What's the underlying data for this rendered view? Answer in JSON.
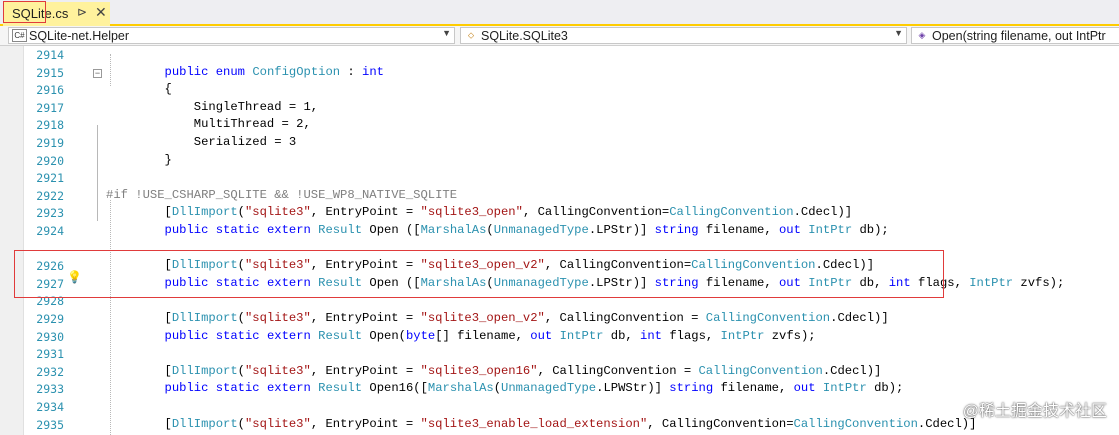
{
  "tab": {
    "filename": "SQLite.cs",
    "pin_glyph": "⊳",
    "close_glyph": "✕"
  },
  "navbar": {
    "project": {
      "icon": "C#",
      "label": "SQLite-net.Helper"
    },
    "type": {
      "icon": "⬦",
      "label": "SQLite.SQLite3"
    },
    "member": {
      "icon": "◈",
      "label": "Open(string filename, out IntPtr"
    }
  },
  "lines": [
    {
      "n": "2914",
      "segs": []
    },
    {
      "n": "2915",
      "segs": [
        {
          "t": "        "
        },
        {
          "t": "public",
          "c": "kw"
        },
        {
          "t": " "
        },
        {
          "t": "enum",
          "c": "kw"
        },
        {
          "t": " "
        },
        {
          "t": "ConfigOption",
          "c": "ty"
        },
        {
          "t": " : "
        },
        {
          "t": "int",
          "c": "kw"
        }
      ]
    },
    {
      "n": "2916",
      "segs": [
        {
          "t": "        {"
        }
      ]
    },
    {
      "n": "2917",
      "segs": [
        {
          "t": "            SingleThread = 1,"
        }
      ]
    },
    {
      "n": "2918",
      "segs": [
        {
          "t": "            MultiThread = 2,"
        }
      ]
    },
    {
      "n": "2919",
      "segs": [
        {
          "t": "            Serialized = 3"
        }
      ]
    },
    {
      "n": "2920",
      "segs": [
        {
          "t": "        }"
        }
      ]
    },
    {
      "n": "2921",
      "segs": []
    },
    {
      "n": "2922",
      "segs": [
        {
          "t": "#if !USE_CSHARP_SQLITE && !USE_WP8_NATIVE_SQLITE",
          "c": "pp"
        }
      ]
    },
    {
      "n": "2923",
      "segs": [
        {
          "t": "        ["
        },
        {
          "t": "DllImport",
          "c": "ty"
        },
        {
          "t": "("
        },
        {
          "t": "\"sqlite3\"",
          "c": "st"
        },
        {
          "t": ", EntryPoint = "
        },
        {
          "t": "\"sqlite3_open\"",
          "c": "st"
        },
        {
          "t": ", CallingConvention="
        },
        {
          "t": "CallingConvention",
          "c": "ty"
        },
        {
          "t": ".Cdecl)]"
        }
      ]
    },
    {
      "n": "2924",
      "segs": [
        {
          "t": "        "
        },
        {
          "t": "public",
          "c": "kw"
        },
        {
          "t": " "
        },
        {
          "t": "static",
          "c": "kw"
        },
        {
          "t": " "
        },
        {
          "t": "extern",
          "c": "kw"
        },
        {
          "t": " "
        },
        {
          "t": "Result",
          "c": "ty"
        },
        {
          "t": " Open (["
        },
        {
          "t": "MarshalAs",
          "c": "ty"
        },
        {
          "t": "("
        },
        {
          "t": "UnmanagedType",
          "c": "ty"
        },
        {
          "t": ".LPStr)] "
        },
        {
          "t": "string",
          "c": "kw"
        },
        {
          "t": " filename, "
        },
        {
          "t": "out",
          "c": "kw"
        },
        {
          "t": " "
        },
        {
          "t": "IntPtr",
          "c": "ty"
        },
        {
          "t": " db);"
        }
      ]
    },
    {
      "n": "",
      "segs": []
    },
    {
      "n": "2926",
      "segs": [
        {
          "t": "        ["
        },
        {
          "t": "DllImport",
          "c": "ty"
        },
        {
          "t": "("
        },
        {
          "t": "\"sqlite3\"",
          "c": "st"
        },
        {
          "t": ", EntryPoint = "
        },
        {
          "t": "\"sqlite3_open_v2\"",
          "c": "st"
        },
        {
          "t": ", CallingConvention="
        },
        {
          "t": "CallingConvention",
          "c": "ty"
        },
        {
          "t": ".Cdecl)]"
        }
      ]
    },
    {
      "n": "2927",
      "segs": [
        {
          "t": "        "
        },
        {
          "t": "public",
          "c": "kw"
        },
        {
          "t": " "
        },
        {
          "t": "static",
          "c": "kw"
        },
        {
          "t": " "
        },
        {
          "t": "extern",
          "c": "kw"
        },
        {
          "t": " "
        },
        {
          "t": "Result",
          "c": "ty"
        },
        {
          "t": " Open (["
        },
        {
          "t": "MarshalAs",
          "c": "ty"
        },
        {
          "t": "("
        },
        {
          "t": "UnmanagedType",
          "c": "ty"
        },
        {
          "t": ".LPStr)] "
        },
        {
          "t": "string",
          "c": "kw"
        },
        {
          "t": " filename, "
        },
        {
          "t": "out",
          "c": "kw"
        },
        {
          "t": " "
        },
        {
          "t": "IntPtr",
          "c": "ty"
        },
        {
          "t": " db, "
        },
        {
          "t": "int",
          "c": "kw"
        },
        {
          "t": " flags, "
        },
        {
          "t": "IntPtr",
          "c": "ty"
        },
        {
          "t": " zvfs);"
        }
      ]
    },
    {
      "n": "2928",
      "segs": []
    },
    {
      "n": "2929",
      "segs": [
        {
          "t": "        ["
        },
        {
          "t": "DllImport",
          "c": "ty"
        },
        {
          "t": "("
        },
        {
          "t": "\"sqlite3\"",
          "c": "st"
        },
        {
          "t": ", EntryPoint = "
        },
        {
          "t": "\"sqlite3_open_v2\"",
          "c": "st"
        },
        {
          "t": ", CallingConvention = "
        },
        {
          "t": "CallingConvention",
          "c": "ty"
        },
        {
          "t": ".Cdecl)]"
        }
      ]
    },
    {
      "n": "2930",
      "segs": [
        {
          "t": "        "
        },
        {
          "t": "public",
          "c": "kw"
        },
        {
          "t": " "
        },
        {
          "t": "static",
          "c": "kw"
        },
        {
          "t": " "
        },
        {
          "t": "extern",
          "c": "kw"
        },
        {
          "t": " "
        },
        {
          "t": "Result",
          "c": "ty"
        },
        {
          "t": " Open("
        },
        {
          "t": "byte",
          "c": "kw"
        },
        {
          "t": "[] filename, "
        },
        {
          "t": "out",
          "c": "kw"
        },
        {
          "t": " "
        },
        {
          "t": "IntPtr",
          "c": "ty"
        },
        {
          "t": " db, "
        },
        {
          "t": "int",
          "c": "kw"
        },
        {
          "t": " flags, "
        },
        {
          "t": "IntPtr",
          "c": "ty"
        },
        {
          "t": " zvfs);"
        }
      ]
    },
    {
      "n": "2931",
      "segs": []
    },
    {
      "n": "2932",
      "segs": [
        {
          "t": "        ["
        },
        {
          "t": "DllImport",
          "c": "ty"
        },
        {
          "t": "("
        },
        {
          "t": "\"sqlite3\"",
          "c": "st"
        },
        {
          "t": ", EntryPoint = "
        },
        {
          "t": "\"sqlite3_open16\"",
          "c": "st"
        },
        {
          "t": ", CallingConvention = "
        },
        {
          "t": "CallingConvention",
          "c": "ty"
        },
        {
          "t": ".Cdecl)]"
        }
      ]
    },
    {
      "n": "2933",
      "segs": [
        {
          "t": "        "
        },
        {
          "t": "public",
          "c": "kw"
        },
        {
          "t": " "
        },
        {
          "t": "static",
          "c": "kw"
        },
        {
          "t": " "
        },
        {
          "t": "extern",
          "c": "kw"
        },
        {
          "t": " "
        },
        {
          "t": "Result",
          "c": "ty"
        },
        {
          "t": " Open16(["
        },
        {
          "t": "MarshalAs",
          "c": "ty"
        },
        {
          "t": "("
        },
        {
          "t": "UnmanagedType",
          "c": "ty"
        },
        {
          "t": ".LPWStr)] "
        },
        {
          "t": "string",
          "c": "kw"
        },
        {
          "t": " filename, "
        },
        {
          "t": "out",
          "c": "kw"
        },
        {
          "t": " "
        },
        {
          "t": "IntPtr",
          "c": "ty"
        },
        {
          "t": " db);"
        }
      ]
    },
    {
      "n": "2934",
      "segs": []
    },
    {
      "n": "2935",
      "segs": [
        {
          "t": "        ["
        },
        {
          "t": "DllImport",
          "c": "ty"
        },
        {
          "t": "("
        },
        {
          "t": "\"sqlite3\"",
          "c": "st"
        },
        {
          "t": ", EntryPoint = "
        },
        {
          "t": "\"sqlite3_enable_load_extension\"",
          "c": "st"
        },
        {
          "t": ", CallingConvention="
        },
        {
          "t": "CallingConvention",
          "c": "ty"
        },
        {
          "t": ".Cdecl)]"
        }
      ]
    }
  ],
  "watermark": "@稀土掘金技术社区"
}
